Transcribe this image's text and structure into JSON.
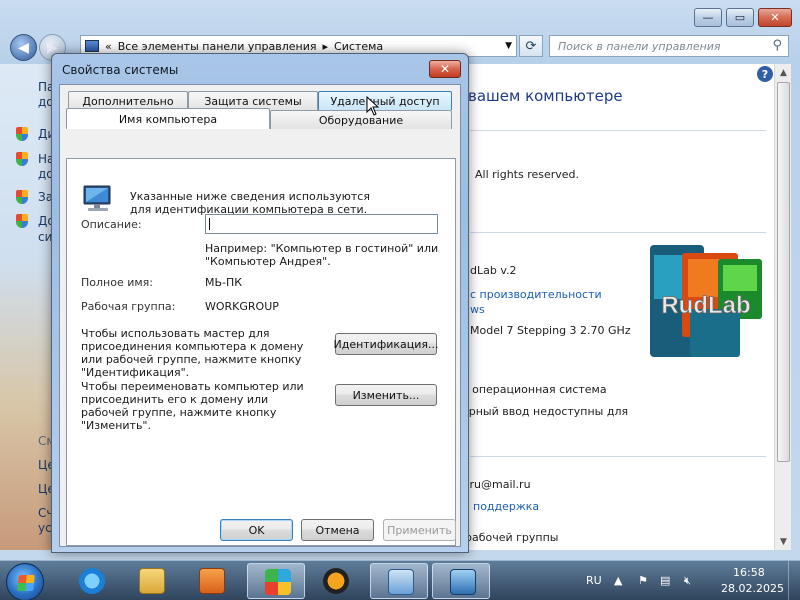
{
  "control_panel": {
    "address_prefix": "«",
    "breadcrumb": [
      "Все элементы панели управления",
      "Система"
    ],
    "breadcrumb_sep": "▸",
    "search_placeholder": "Поиск в панели управления",
    "left_pane_fragments": [
      "Па",
      "до",
      "Ди",
      "На",
      "до",
      "За",
      "До",
      "си",
      "См",
      "Це",
      "Це",
      "Сч",
      "ус"
    ],
    "main_heading": "вашем компьютере",
    "copyright": "All rights reserved.",
    "oem_name": "dLab v.2",
    "perf_link": "с производительности",
    "ws_link": "ws",
    "cpu_info": "Model 7 Stepping 3   2.70 GHz",
    "os_type": "я операционная система",
    "pen_input": "орный ввод недоступны для",
    "email": ".ru@mail.ru",
    "support_link": "поддержка",
    "workgroup_section": "рабочей группы",
    "logo_text": "RudLab"
  },
  "dialog": {
    "title": "Свойства системы",
    "close_label": "✕",
    "tabs_back": [
      "Дополнительно",
      "Защита системы",
      "Удаленный доступ"
    ],
    "tabs_front": [
      "Имя компьютера",
      "Оборудование"
    ],
    "intro": "Указанные ниже сведения используются для идентификации компьютера в сети.",
    "description_label": "Описание:",
    "description_value": "",
    "example": "Например: \"Компьютер в гостиной\" или \"Компьютер Андрея\".",
    "full_name_label": "Полное имя:",
    "full_name_value": "МЬ-ПК",
    "workgroup_label": "Рабочая группа:",
    "workgroup_value": "WORKGROUP",
    "wizard_text": "Чтобы использовать мастер для присоединения компьютера к домену или рабочей группе, нажмите кнопку \"Идентификация\".",
    "identification_button": "Идентификация...",
    "rename_text": "Чтобы переименовать компьютер или присоединить его к домену или рабочей группе, нажмите кнопку \"Изменить\".",
    "change_button": "Изменить...",
    "ok_button": "OK",
    "cancel_button": "Отмена",
    "apply_button": "Применить"
  },
  "taskbar": {
    "language": "RU",
    "time": "16:58",
    "date": "28.02.2025"
  }
}
